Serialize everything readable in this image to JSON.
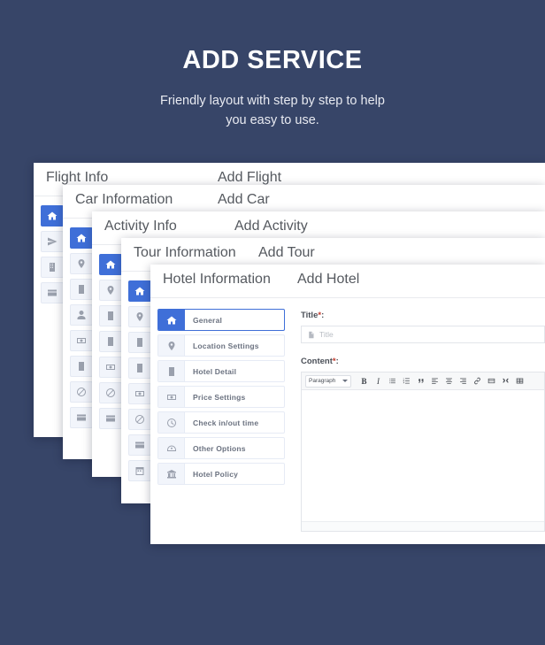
{
  "hero": {
    "title": "ADD SERVICE",
    "subtitle_line1": "Friendly layout with step by step to help",
    "subtitle_line2": "you easy to use."
  },
  "colors": {
    "background": "#374568",
    "accent": "#3f6fd8",
    "card": "#ffffff",
    "muted_text": "#6b7280",
    "required": "#c0392b"
  },
  "cards": [
    {
      "id": "flight",
      "title_left": "Flight Info",
      "title_right": "Add Flight",
      "icons": [
        "home-icon",
        "paper-plane-icon",
        "building-icon",
        "credit-card-icon"
      ]
    },
    {
      "id": "car",
      "title_left": "Car Information",
      "title_right": "Add Car",
      "icons": [
        "home-icon",
        "map-pin-icon",
        "building-icon",
        "user-icon",
        "money-icon",
        "building-icon",
        "ban-icon",
        "credit-card-icon"
      ]
    },
    {
      "id": "activity",
      "title_left": "Activity Info",
      "title_right": "Add Activity",
      "icons": [
        "home-icon",
        "map-pin-icon",
        "building-icon",
        "building-icon",
        "money-icon",
        "ban-icon",
        "credit-card-icon"
      ]
    },
    {
      "id": "tour",
      "title_left": "Tour Information",
      "title_right": "Add Tour",
      "icons": [
        "home-icon",
        "map-pin-icon",
        "building-icon",
        "building-icon",
        "money-icon",
        "ban-icon",
        "credit-card-icon",
        "calendar-icon"
      ]
    }
  ],
  "hotel": {
    "title_left": "Hotel Information",
    "title_right": "Add Hotel",
    "nav": [
      {
        "label": "General",
        "icon": "home-icon",
        "active": true
      },
      {
        "label": "Location Settings",
        "icon": "map-pin-icon",
        "active": false
      },
      {
        "label": "Hotel Detail",
        "icon": "building-icon",
        "active": false
      },
      {
        "label": "Price Settings",
        "icon": "money-icon",
        "active": false
      },
      {
        "label": "Check in/out time",
        "icon": "clock-icon",
        "active": false
      },
      {
        "label": "Other Options",
        "icon": "gauge-icon",
        "active": false
      },
      {
        "label": "Hotel Policy",
        "icon": "bank-icon",
        "active": false
      }
    ],
    "form": {
      "title_label": "Title",
      "title_required_mark": "*",
      "title_colon": ":",
      "title_placeholder": "Title",
      "title_value": "",
      "content_label": "Content",
      "content_required_mark": "*",
      "content_colon": ":",
      "content_value": ""
    },
    "editor_toolbar": {
      "format_select_value": "Paragraph",
      "buttons": [
        "bold-icon",
        "italic-icon",
        "unordered-list-icon",
        "ordered-list-icon",
        "blockquote-icon",
        "align-left-icon",
        "align-center-icon",
        "align-right-icon",
        "link-icon",
        "insert-media-icon",
        "shuffle-icon",
        "table-icon"
      ]
    }
  }
}
